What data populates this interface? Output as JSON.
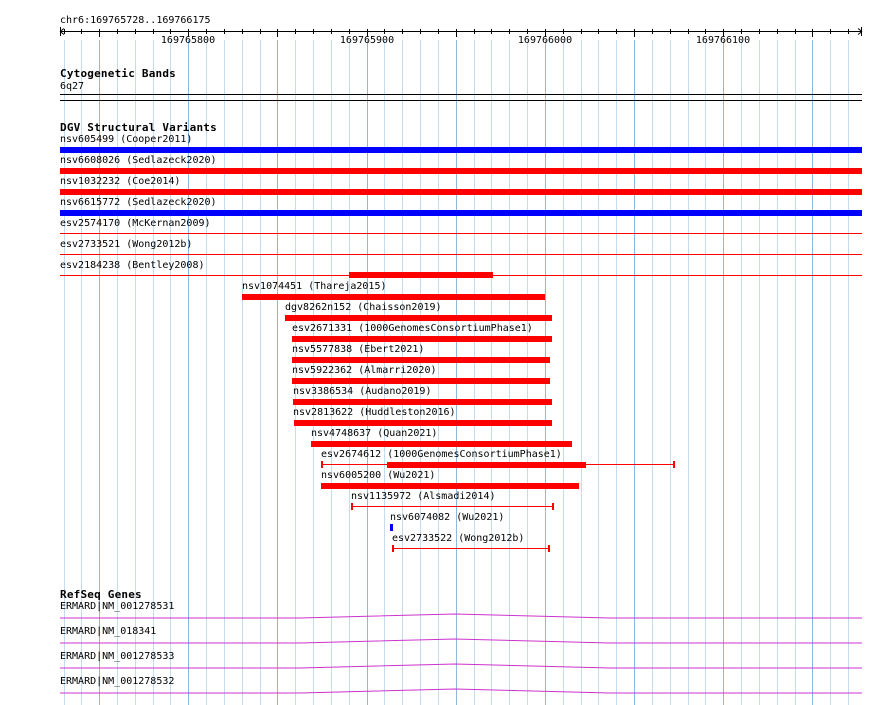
{
  "ruler": {
    "region": "chr6:169765728..169766175",
    "ticks": [
      "169765800",
      "169765900",
      "169766000",
      "169766100"
    ]
  },
  "cytoband": {
    "title": "Cytogenetic Bands",
    "band": "6q27"
  },
  "dgv": {
    "title": "DGV Structural Variants",
    "colors": {
      "gain": "#0000ff",
      "loss": "#ff0000"
    },
    "full_rows": [
      {
        "label": "nsv605499 (Cooper2011)",
        "type": "gain",
        "style": "thick"
      },
      {
        "label": "nsv6608026 (Sedlazeck2020)",
        "type": "loss",
        "style": "thick"
      },
      {
        "label": "nsv1032232 (Coe2014)",
        "type": "loss",
        "style": "thick"
      },
      {
        "label": "nsv6615772 (Sedlazeck2020)",
        "type": "gain",
        "style": "thick"
      },
      {
        "label": "esv2574170 (McKernan2009)",
        "type": "loss",
        "style": "thin"
      },
      {
        "label": "esv2733521 (Wong2012b)",
        "type": "loss",
        "style": "thin"
      },
      {
        "label": "esv2184238 (Bentley2008)",
        "type": "loss",
        "style": "thin"
      }
    ],
    "stacked": [
      {
        "label": "nsv1074451 (Thareja2015)",
        "type": "loss",
        "style": "thick"
      },
      {
        "label": "dgv8262n152 (Chaisson2019)",
        "type": "loss",
        "style": "thick"
      },
      {
        "label": "esv2671331 (1000GenomesConsortiumPhase1)",
        "type": "loss",
        "style": "thick"
      },
      {
        "label": "nsv5577838 (Ebert2021)",
        "type": "loss",
        "style": "thick"
      },
      {
        "label": "nsv5922362 (Almarri2020)",
        "type": "loss",
        "style": "thick"
      },
      {
        "label": "nsv3386534 (Audano2019)",
        "type": "loss",
        "style": "thick"
      },
      {
        "label": "nsv2813622 (Huddleston2016)",
        "type": "loss",
        "style": "thick"
      },
      {
        "label": "nsv4748637 (Quan2021)",
        "type": "loss",
        "style": "thick"
      },
      {
        "label": "esv2674612 (1000GenomesConsortiumPhase1)",
        "type": "loss",
        "style": "range"
      },
      {
        "label": "nsv6005200 (Wu2021)",
        "type": "loss",
        "style": "thick"
      },
      {
        "label": "nsv1135972 (Alsmadi2014)",
        "type": "loss",
        "style": "range"
      },
      {
        "label": "nsv6074082 (Wu2021)",
        "type": "gain",
        "style": "tiny"
      },
      {
        "label": "esv2733522 (Wong2012b)",
        "type": "loss",
        "style": "range"
      }
    ]
  },
  "refseq": {
    "title": "RefSeq Genes",
    "color": "#cc33cc",
    "genes": [
      {
        "label": "ERMARD|NM_001278531"
      },
      {
        "label": "ERMARD|NM_018341"
      },
      {
        "label": "ERMARD|NM_001278533"
      },
      {
        "label": "ERMARD|NM_001278532"
      }
    ]
  }
}
